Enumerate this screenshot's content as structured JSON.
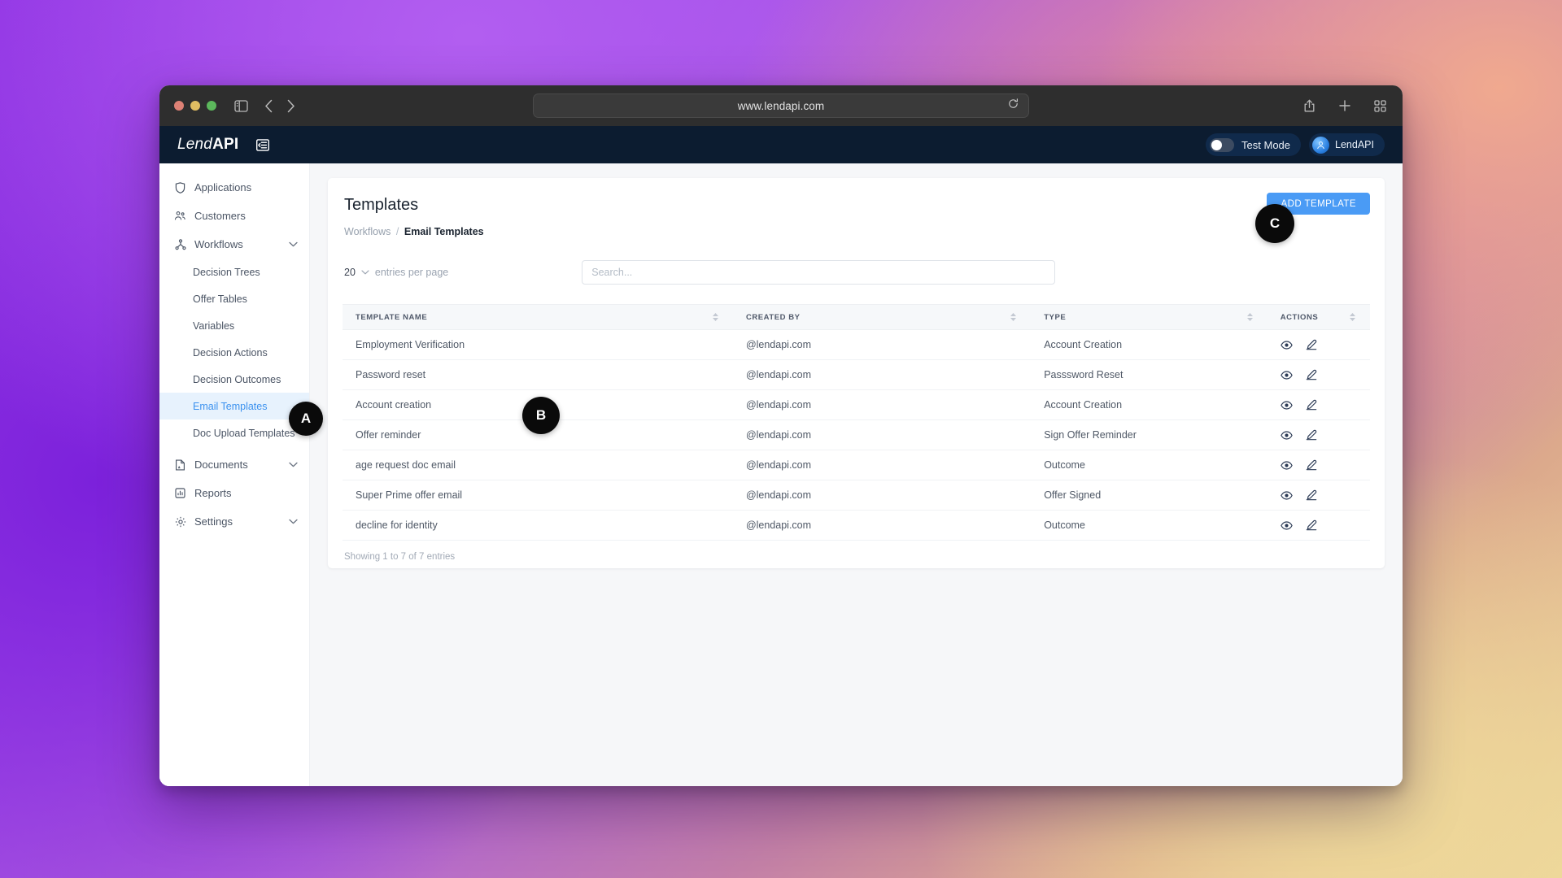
{
  "browser": {
    "url": "www.lendapi.com",
    "icons": {
      "sidebar_toggle": "sidebar-toggle-icon",
      "back": "back-arrow-icon",
      "forward": "forward-arrow-icon",
      "reload": "reload-icon",
      "share": "share-icon",
      "new_tab": "plus-icon",
      "tab_overview": "grid-icon"
    }
  },
  "appbar": {
    "logo_first": "Lend",
    "logo_second": "API",
    "collapse_icon": "menu-collapse-icon",
    "test_mode_label": "Test Mode",
    "test_mode_on": false,
    "org_label": "LendAPI"
  },
  "sidebar": {
    "items": [
      {
        "label": "Applications",
        "icon": "applications-icon",
        "type": "top",
        "expandable": false
      },
      {
        "label": "Customers",
        "icon": "customers-icon",
        "type": "top",
        "expandable": false
      },
      {
        "label": "Workflows",
        "icon": "workflows-icon",
        "type": "top",
        "expandable": true
      },
      {
        "label": "Decision Trees",
        "type": "sub",
        "active": false
      },
      {
        "label": "Offer Tables",
        "type": "sub",
        "active": false
      },
      {
        "label": "Variables",
        "type": "sub",
        "active": false
      },
      {
        "label": "Decision Actions",
        "type": "sub",
        "active": false
      },
      {
        "label": "Decision Outcomes",
        "type": "sub",
        "active": false
      },
      {
        "label": "Email Templates",
        "type": "sub",
        "active": true
      },
      {
        "label": "Doc Upload Templates",
        "type": "sub",
        "active": false
      },
      {
        "label": "Documents",
        "icon": "documents-icon",
        "type": "top",
        "expandable": true
      },
      {
        "label": "Reports",
        "icon": "reports-icon",
        "type": "top",
        "expandable": false
      },
      {
        "label": "Settings",
        "icon": "settings-icon",
        "type": "top",
        "expandable": true
      }
    ]
  },
  "page": {
    "title": "Templates",
    "breadcrumb_parent": "Workflows",
    "breadcrumb_sep": "/",
    "breadcrumb_current": "Email Templates",
    "add_button": "ADD TEMPLATE"
  },
  "controls": {
    "entries_value": "20",
    "entries_label": "entries per page",
    "search_placeholder": "Search...",
    "search_value": ""
  },
  "table": {
    "columns": [
      "TEMPLATE NAME",
      "CREATED BY",
      "TYPE",
      "ACTIONS"
    ],
    "rows": [
      {
        "name": "Employment Verification",
        "created_by": "@lendapi.com",
        "type": "Account Creation"
      },
      {
        "name": "Password reset",
        "created_by": "@lendapi.com",
        "type": "Passsword Reset"
      },
      {
        "name": "Account creation",
        "created_by": "@lendapi.com",
        "type": "Account Creation"
      },
      {
        "name": "Offer reminder",
        "created_by": "@lendapi.com",
        "type": "Sign Offer Reminder"
      },
      {
        "name": "age request doc email",
        "created_by": "@lendapi.com",
        "type": "Outcome"
      },
      {
        "name": "Super Prime offer email",
        "created_by": "@lendapi.com",
        "type": "Offer Signed"
      },
      {
        "name": "decline for identity",
        "created_by": "@lendapi.com",
        "type": "Outcome"
      }
    ],
    "row_actions": {
      "view": "eye-icon",
      "edit": "pencil-edit-icon"
    },
    "footer": "Showing 1 to 7 of 7 entries"
  },
  "annotations": [
    {
      "id": "A",
      "label": "A"
    },
    {
      "id": "B",
      "label": "B"
    },
    {
      "id": "C",
      "label": "C"
    }
  ],
  "colors": {
    "accent_blue": "#4a9bf5",
    "active_nav_blue": "#3c92ef",
    "active_nav_bg": "#e7f2fd",
    "appbar_navy": "#0c1c30",
    "badge_black": "#0a0a0a"
  }
}
